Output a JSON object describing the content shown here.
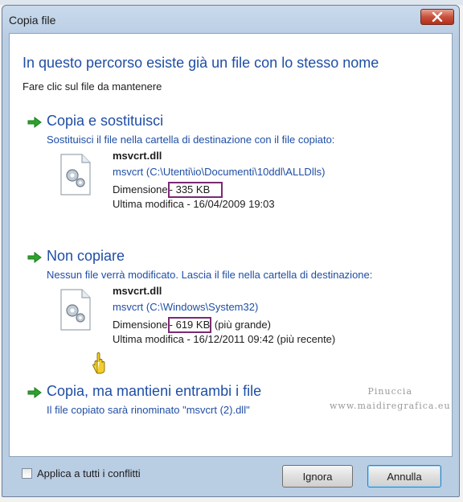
{
  "window": {
    "title": "Copia file",
    "close_icon": "close-icon"
  },
  "dialog": {
    "heading": "In questo percorso esiste già un file con lo stesso nome",
    "subheading": "Fare clic sul file da mantenere"
  },
  "options": [
    {
      "title": "Copia e sostituisci",
      "description": "Sostituisci il file nella cartella di destinazione con il file copiato:",
      "icon": "green-arrow-icon",
      "file": {
        "name": "msvcrt.dll",
        "path": "msvcrt (C:\\Utenti\\io\\Documenti\\10ddl\\ALLDlls)",
        "size_label": "Dimensione",
        "size_value": "- 335 KB",
        "size_note": "",
        "modified": "Ultima modifica - 16/04/2009 19:03"
      }
    },
    {
      "title": "Non copiare",
      "description": "Nessun file verrà modificato. Lascia il file nella cartella di destinazione:",
      "icon": "green-arrow-icon",
      "file": {
        "name": "msvcrt.dll",
        "path": "msvcrt (C:\\Windows\\System32)",
        "size_label": "Dimensione",
        "size_value": "- 619 KB",
        "size_note": "(più grande)",
        "modified": "Ultima modifica - 16/12/2011 09:42 (più recente)"
      }
    },
    {
      "title": "Copia, ma mantieni entrambi i file",
      "description": "Il file copiato sarà rinominato \"msvcrt (2).dll\"",
      "icon": "green-arrow-icon"
    }
  ],
  "watermark": {
    "line1": "Pinuccia",
    "line2": "www.maidiregrafica.eu"
  },
  "footer": {
    "apply_all_label": "Applica a tutti i conflitti",
    "apply_all_checked": false,
    "ignore_label": "Ignora",
    "cancel_label": "Annulla"
  },
  "colors": {
    "accent_blue": "#1f4ea5",
    "highlight_box": "#7a2a73",
    "arrow_green": "#2aa52a"
  }
}
